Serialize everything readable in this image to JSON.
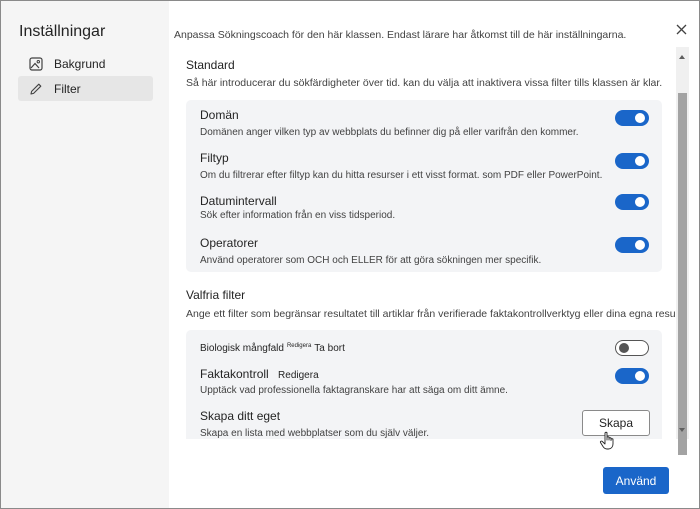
{
  "sidebar": {
    "title": "Inställningar",
    "items": [
      {
        "label": "Bakgrund",
        "icon": "image-icon"
      },
      {
        "label": "Filter",
        "icon": "pencil-icon"
      }
    ]
  },
  "header": {
    "description": "Anpassa Sökningscoach för den här klassen. Endast lärare har åtkomst till de här inställningarna."
  },
  "standard": {
    "title": "Standard",
    "description": "Så här introducerar du sökfärdigheter över tid. kan du välja att inaktivera vissa filter tills klassen är klar.",
    "filters": [
      {
        "title": "Domän",
        "description": "Domänen anger vilken typ av webbplats du befinner dig på eller varifrån den kommer.",
        "enabled": true
      },
      {
        "title": "Filtyp",
        "description": "Om du filtrerar efter filtyp kan du hitta resurser i ett visst format. som PDF eller PowerPoint.",
        "enabled": true
      },
      {
        "title": "Datumintervall",
        "description": "Sök efter information från en viss tidsperiod.",
        "enabled": true
      },
      {
        "title": "Operatorer",
        "description": "Använd operatorer som OCH och ELLER för att göra sökningen mer specifik.",
        "enabled": true
      }
    ]
  },
  "optional": {
    "title": "Valfria filter",
    "description": "Ange ett filter som begränsar resultatet till artiklar från verifierade faktakontrollverktyg eller dina egna resurser.",
    "biodiversity": {
      "title": "Biologisk mångfald",
      "edit": "Redigera",
      "remove": "Ta bort",
      "enabled": false
    },
    "factcheck": {
      "title": "Faktakontroll",
      "edit": "Redigera",
      "description": "Upptäck vad professionella faktagranskare har att säga om ditt ämne.",
      "enabled": true
    },
    "custom": {
      "title": "Skapa ditt eget",
      "description": "Skapa en lista med webbplatser som du själv väljer.",
      "button": "Skapa"
    }
  },
  "footer": {
    "apply": "Använd"
  },
  "colors": {
    "accent": "#1a66c9",
    "sidebar_bg": "#f5f5f5",
    "card_bg": "#f3f4f6"
  }
}
